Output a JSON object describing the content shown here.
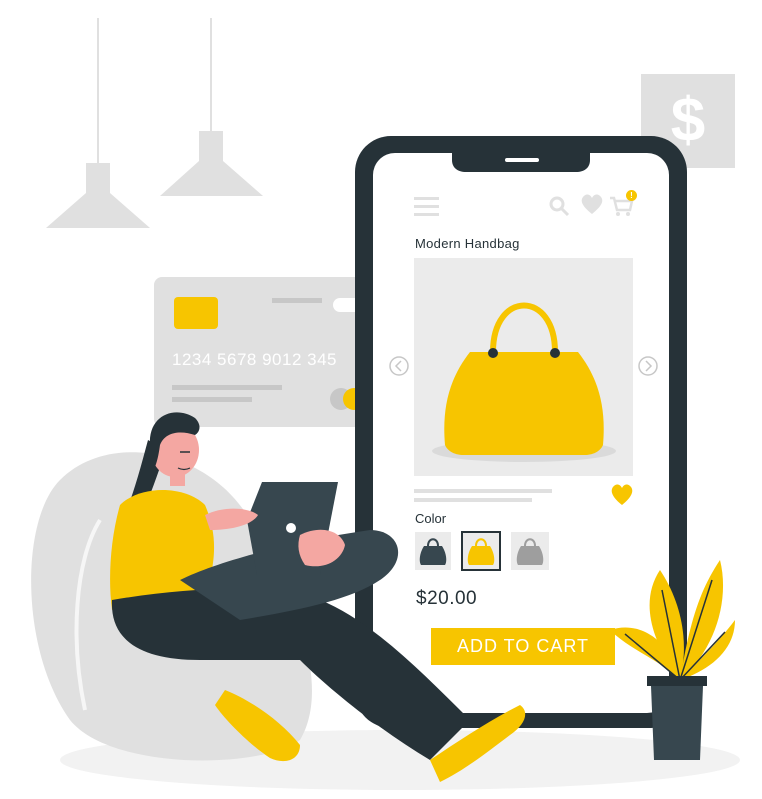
{
  "colors": {
    "accent": "#F7C500",
    "dark": "#263238",
    "light_gray": "#E0E0E0",
    "mid_gray": "#C7C7C7",
    "skin": "#F4A7A2"
  },
  "card": {
    "number": "1234 5678 9012 345"
  },
  "wall_sign": {
    "symbol": "$"
  },
  "phone": {
    "header_icons": [
      "menu-icon",
      "search-icon",
      "heart-icon",
      "cart-icon"
    ],
    "cart_badge": "!",
    "product": {
      "title": "Modern Handbag",
      "color_label": "Color",
      "color_options": [
        "dark-teal",
        "yellow",
        "gray"
      ],
      "selected_color": "yellow",
      "price": "$20.00",
      "add_to_cart_label": "ADD TO CART"
    }
  }
}
